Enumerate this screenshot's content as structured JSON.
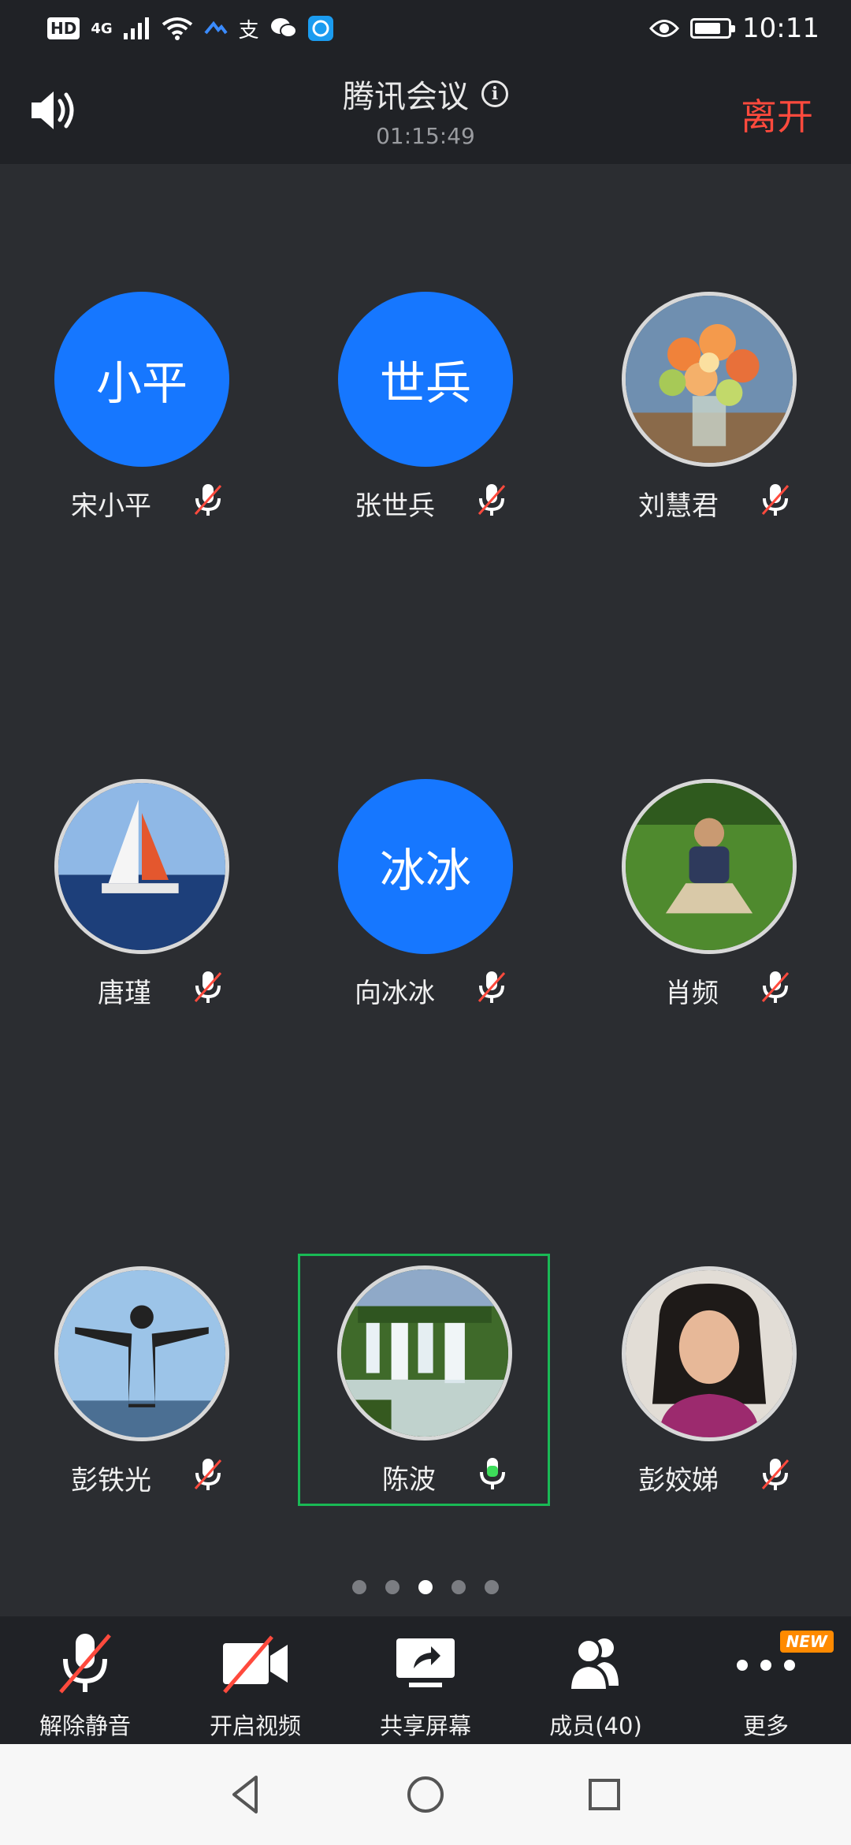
{
  "status_bar": {
    "hd": "HD",
    "network": "4G",
    "alipay_glyph": "支",
    "time": "10:11",
    "icons": [
      "signal-icon",
      "wifi-icon",
      "app-icon",
      "alipay-icon",
      "wechat-icon",
      "browser-icon",
      "eye-icon",
      "battery-icon"
    ]
  },
  "header": {
    "title": "腾讯会议",
    "elapsed": "01:15:49",
    "leave_label": "离开",
    "leave_color": "#ff4a3d"
  },
  "participants": [
    {
      "name": "宋小平",
      "avatar_text": "小平",
      "mic": "muted"
    },
    {
      "name": "张世兵",
      "avatar_text": "世兵",
      "mic": "muted"
    },
    {
      "name": "刘慧君",
      "avatar_photo": "flowers",
      "mic": "muted"
    },
    {
      "name": "唐瑾",
      "avatar_photo": "sailboat",
      "mic": "muted"
    },
    {
      "name": "向冰冰",
      "avatar_text": "冰冰",
      "mic": "muted"
    },
    {
      "name": "肖频",
      "avatar_photo": "man-on-grass",
      "mic": "muted"
    },
    {
      "name": "彭铁光",
      "avatar_photo": "silhouette",
      "mic": "muted"
    },
    {
      "name": "陈波",
      "avatar_photo": "waterfall",
      "mic": "active",
      "speaking": true
    },
    {
      "name": "彭姣娣",
      "avatar_photo": "woman-portrait",
      "mic": "muted"
    }
  ],
  "colors": {
    "avatar_blue": "#1677ff",
    "speaking_border": "#19b955",
    "mic_active": "#3ddc5a",
    "mic_muted_slash": "#ff4a3d"
  },
  "pagination": {
    "pages": 5,
    "current": 3
  },
  "toolbar": {
    "unmute_label": "解除静音",
    "video_label": "开启视频",
    "share_label": "共享屏幕",
    "members_label": "成员(40)",
    "more_label": "更多",
    "new_badge": "NEW"
  },
  "nav": {
    "icons": [
      "back-icon",
      "home-icon",
      "recents-icon"
    ]
  }
}
